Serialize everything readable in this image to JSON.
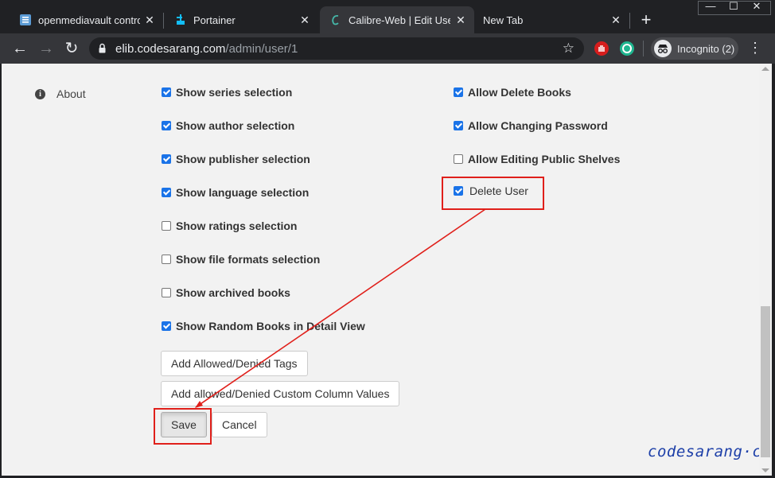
{
  "browser": {
    "tabs": [
      {
        "title": "openmediavault control",
        "icon": "omv-icon",
        "active": false
      },
      {
        "title": "Portainer",
        "icon": "portainer-icon",
        "active": false
      },
      {
        "title": "Calibre-Web | Edit User a",
        "icon": "calibre-icon",
        "active": true
      },
      {
        "title": "New Tab",
        "icon": "",
        "active": false
      }
    ],
    "new_tab_label": "+",
    "window_controls": {
      "minimize": "—",
      "maximize": "☐",
      "close": "✕"
    },
    "close_glyph": "✕",
    "nav": {
      "back": "←",
      "forward": "→",
      "reload": "↻"
    },
    "url_host": "elib.codesarang.com",
    "url_path": "/admin/user/1",
    "star_glyph": "☆",
    "incognito_label": "Incognito (2)",
    "menu_glyph": "⋮",
    "accent_color": "#1a73e8"
  },
  "sidebar": {
    "about_label": "About",
    "about_icon": "info-circle-icon"
  },
  "left_options": [
    {
      "label": "Show series selection",
      "checked": true
    },
    {
      "label": "Show author selection",
      "checked": true
    },
    {
      "label": "Show publisher selection",
      "checked": true
    },
    {
      "label": "Show language selection",
      "checked": true
    },
    {
      "label": "Show ratings selection",
      "checked": false
    },
    {
      "label": "Show file formats selection",
      "checked": false
    },
    {
      "label": "Show archived books",
      "checked": false
    },
    {
      "label": "Show Random Books in Detail View",
      "checked": true
    }
  ],
  "right_options": [
    {
      "label": "Allow Delete Books",
      "checked": true
    },
    {
      "label": "Allow Changing Password",
      "checked": true
    },
    {
      "label": "Allow Editing Public Shelves",
      "checked": false
    }
  ],
  "delete_user": {
    "label": "Delete User",
    "checked": true
  },
  "buttons": {
    "tags": "Add Allowed/Denied Tags",
    "custom_columns": "Add allowed/Denied Custom Column Values",
    "save": "Save",
    "cancel": "Cancel"
  },
  "annotation_color": "#e0201b",
  "watermark": "codesarang·com"
}
